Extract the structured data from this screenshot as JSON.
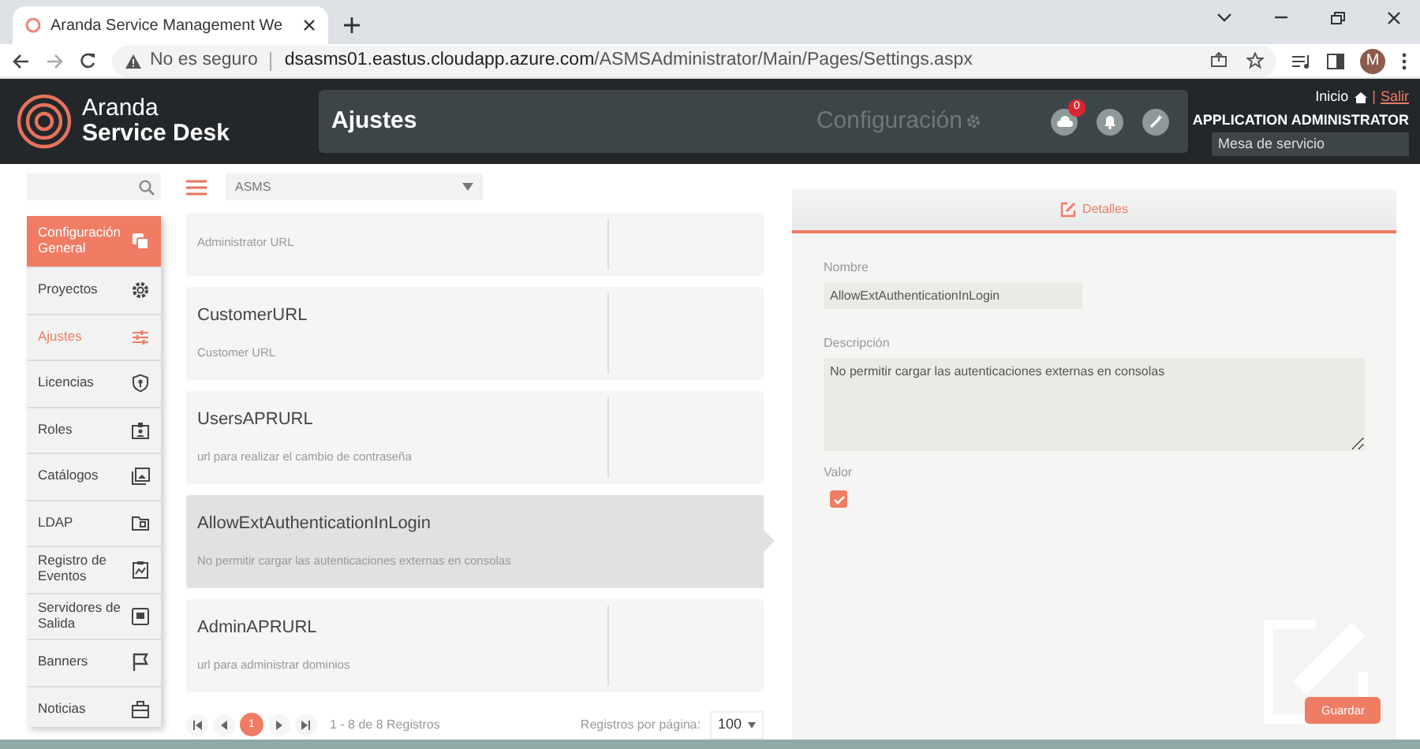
{
  "browser": {
    "tab_title": "Aranda Service Management We",
    "security": "No es seguro",
    "url_host": "dsasms01.eastus.cloudapp.azure.com",
    "url_path": "/ASMSAdministrator/Main/Pages/Settings.aspx",
    "profile_initial": "M"
  },
  "header": {
    "logo_line1": "Aranda",
    "logo_line2": "Service Desk",
    "page_title": "Ajustes",
    "section": "Configuración",
    "notification_count": "0",
    "home_link": "Inicio",
    "separator": "|",
    "logout_link": "Salir",
    "user_name": "APPLICATION ADMINISTRATOR",
    "service_desk": "Mesa de servicio"
  },
  "sidebar": {
    "items": [
      {
        "label": "Configuración General",
        "kind": "header",
        "selected": false
      },
      {
        "label": "Proyectos",
        "kind": "item",
        "selected": false
      },
      {
        "label": "Ajustes",
        "kind": "item",
        "selected": true
      },
      {
        "label": "Licencias",
        "kind": "item",
        "selected": false
      },
      {
        "label": "Roles",
        "kind": "item",
        "selected": false
      },
      {
        "label": "Catálogos",
        "kind": "item",
        "selected": false
      },
      {
        "label": "LDAP",
        "kind": "item",
        "selected": false
      },
      {
        "label": "Registro de Eventos",
        "kind": "item",
        "selected": false
      },
      {
        "label": "Servidores de Salida",
        "kind": "item",
        "selected": false
      },
      {
        "label": "Banners",
        "kind": "item",
        "selected": false
      },
      {
        "label": "Noticias",
        "kind": "item",
        "selected": false
      }
    ]
  },
  "filter": {
    "selected": "ASMS"
  },
  "settings": [
    {
      "description": "Administrator URL",
      "selected": false
    },
    {
      "name": "CustomerURL",
      "description": "Customer URL",
      "selected": false
    },
    {
      "name": "UsersAPRURL",
      "description": "url para realizar el cambio de contraseña",
      "selected": false
    },
    {
      "name": "AllowExtAuthenticationInLogin",
      "description": "No permitir cargar las autenticaciones externas en consolas",
      "selected": true
    },
    {
      "name": "AdminAPRURL",
      "description": "url para administrar dominios",
      "selected": false
    }
  ],
  "pagination": {
    "pages": [
      {
        "label": "1",
        "selected": true
      }
    ],
    "summary": "1 - 8 de 8 Registros",
    "page_size_label": "Registros por página:",
    "page_size": "100"
  },
  "details": {
    "tab": "Detalles",
    "name_label": "Nombre",
    "name_value": "AllowExtAuthenticationInLogin",
    "description_label": "Descripción",
    "description_value": "No permitir cargar las autenticaciones externas en consolas",
    "value_label": "Valor",
    "value_checked": true,
    "save_button": "Guardar"
  }
}
